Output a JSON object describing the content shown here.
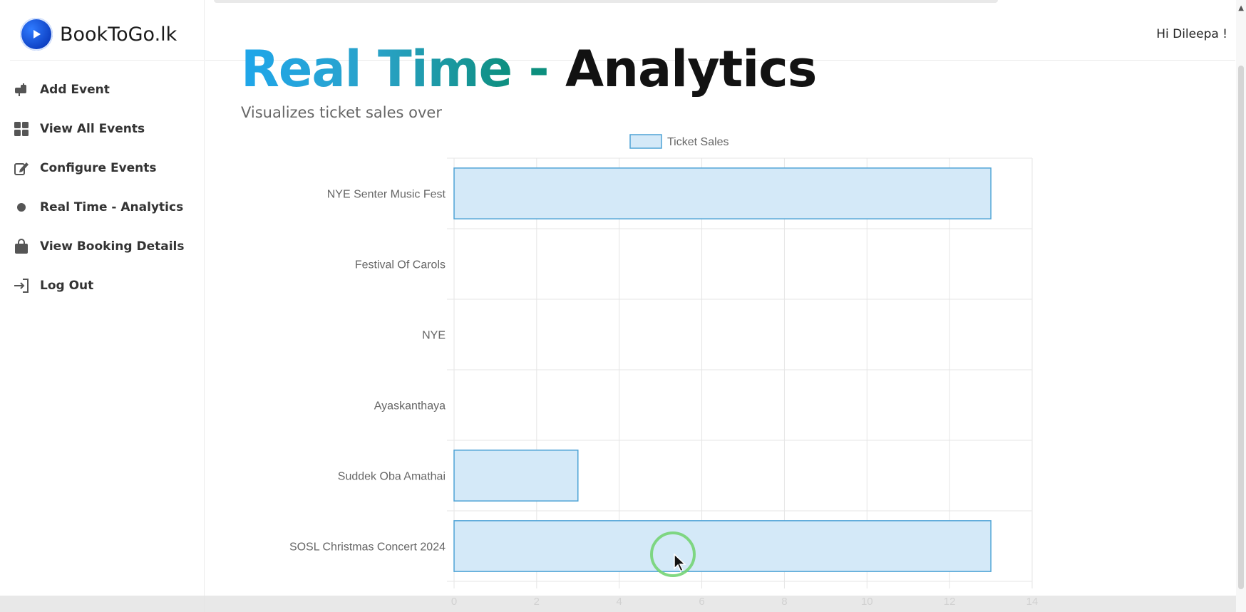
{
  "brand": {
    "name": "BookToGo.lk",
    "logo_icon": "play-icon"
  },
  "header": {
    "greeting": "Hi Dileepa !"
  },
  "sidebar": {
    "items": [
      {
        "label": "Add Event",
        "icon": "mailbox-icon"
      },
      {
        "label": "View All Events",
        "icon": "grid-icon"
      },
      {
        "label": "Configure Events",
        "icon": "edit-icon"
      },
      {
        "label": "Real Time - Analytics",
        "icon": "dot-icon"
      },
      {
        "label": "View Booking Details",
        "icon": "bag-icon"
      },
      {
        "label": "Log Out",
        "icon": "logout-icon"
      }
    ]
  },
  "main": {
    "title_part1": "Real Time",
    "title_dash": " - ",
    "title_part2": "Analytics",
    "subtitle": "Visualizes ticket sales over"
  },
  "colors": {
    "bar_fill": "#d4e9f8",
    "bar_stroke": "#4ea3d6",
    "title_gradient_start": "#1fa6ea",
    "title_gradient_end": "#0d8f7e"
  },
  "chart_data": {
    "type": "bar",
    "orientation": "horizontal",
    "categories": [
      "NYE Senter Music Fest",
      "Festival Of Carols",
      "NYE",
      "Ayaskanthaya",
      "Suddek Oba Amathai",
      "SOSL Christmas Concert 2024"
    ],
    "series": [
      {
        "name": "Ticket Sales",
        "values": [
          13,
          0,
          0,
          0,
          3,
          13
        ]
      }
    ],
    "xlim": [
      0,
      14
    ],
    "xticks": [
      0,
      2,
      4,
      6,
      8,
      10,
      12,
      14
    ],
    "grid": true,
    "legend": "top"
  }
}
